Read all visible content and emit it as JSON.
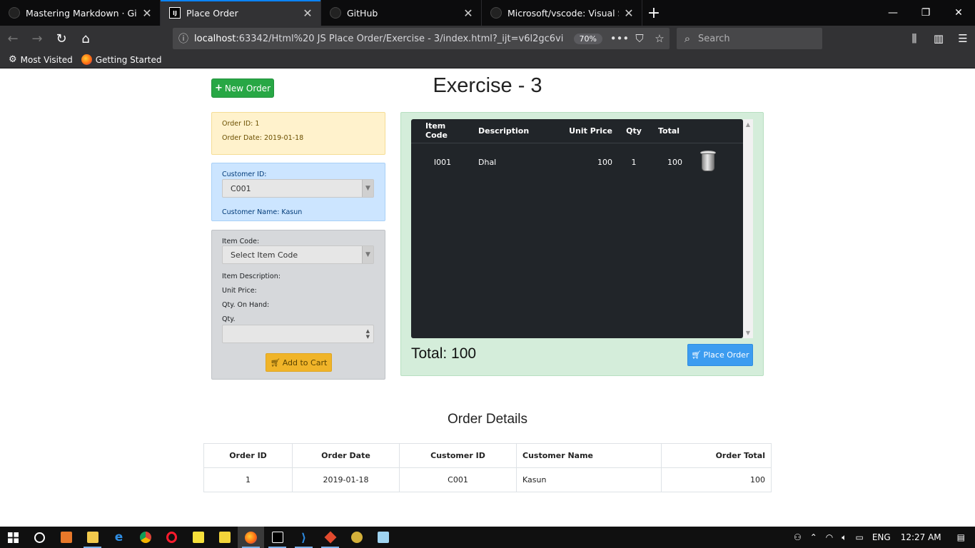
{
  "browser": {
    "tabs": [
      {
        "title": "Mastering Markdown · GitHub",
        "favicon": "github-icon",
        "active": false
      },
      {
        "title": "Place Order",
        "favicon": "intellij-icon",
        "active": true
      },
      {
        "title": "GitHub",
        "favicon": "github-icon",
        "active": false
      },
      {
        "title": "Microsoft/vscode: Visual Studio",
        "favicon": "github-icon",
        "active": false
      }
    ],
    "url_host": "localhost",
    "url_rest": ":63342/Html%20 JS Place Order/Exercise - 3/index.html?_ijt=v6l2gc6vi",
    "zoom": "70%",
    "search_placeholder": "Search",
    "bookmarks": [
      "Most Visited",
      "Getting Started"
    ]
  },
  "page": {
    "new_order_label": "New Order",
    "title": "Exercise - 3",
    "order_info": {
      "order_id": "Order ID: 1",
      "order_date": "Order Date: 2019-01-18"
    },
    "customer": {
      "id_label": "Customer ID:",
      "selected_id": "C001",
      "name_line": "Customer Name: Kasun"
    },
    "item_form": {
      "code_label": "Item Code:",
      "code_placeholder": "Select Item Code",
      "description_label": "Item Description:",
      "unit_price_label": "Unit Price:",
      "qty_on_hand_label": "Qty. On Hand:",
      "qty_label": "Qty.",
      "add_to_cart_label": "Add to Cart"
    },
    "cart": {
      "headers": [
        "Item Code",
        "Description",
        "Unit Price",
        "Qty",
        "Total"
      ],
      "rows": [
        {
          "code": "I001",
          "description": "Dhal",
          "unit_price": "100",
          "qty": "1",
          "total": "100"
        }
      ],
      "total_text": "Total: 100",
      "place_order_label": "Place Order"
    },
    "order_details": {
      "title": "Order Details",
      "headers": [
        "Order ID",
        "Order Date",
        "Customer ID",
        "Customer Name",
        "Order Total"
      ],
      "rows": [
        {
          "id": "1",
          "date": "2019-01-18",
          "customer_id": "C001",
          "customer_name": "Kasun",
          "total": "100"
        }
      ]
    }
  },
  "taskbar": {
    "language": "ENG",
    "time": "12:27 AM"
  },
  "colors": {
    "success": "#28a745",
    "warning_bg": "#fff2cc",
    "info_bg": "#cce5ff",
    "secondary_bg": "#d6d8db",
    "cart_panel_bg": "#d4edda",
    "dark_table": "#212529",
    "primary_btn": "#3c9cf0",
    "cart_btn": "#f0b429"
  }
}
